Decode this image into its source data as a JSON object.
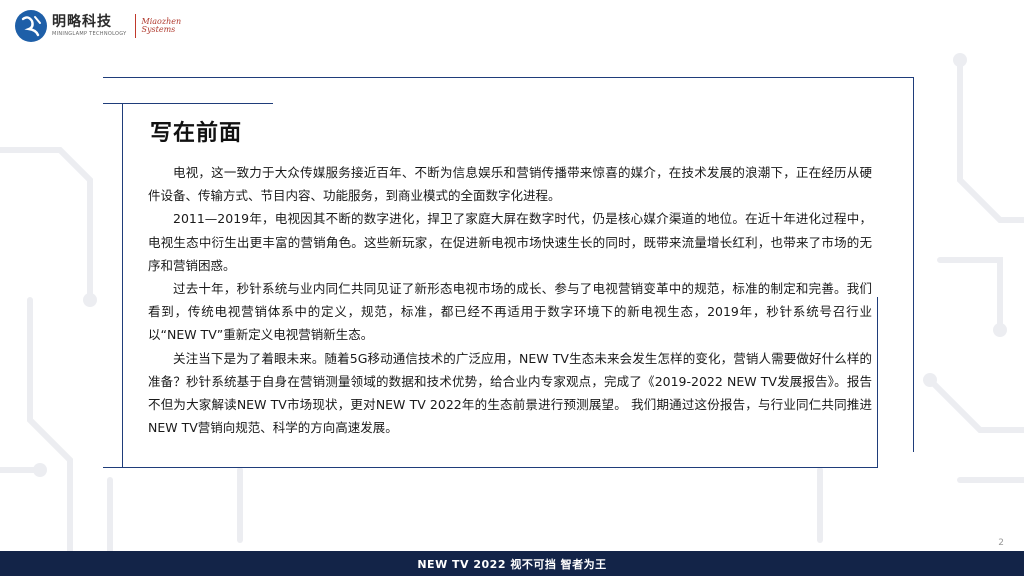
{
  "header": {
    "logo_cn": "明略科技",
    "logo_en": "MININGLAMP TECHNOLOGY",
    "sub_line1": "Miaozhen",
    "sub_line2": "Systems"
  },
  "slide": {
    "title": "写在前面",
    "paragraphs": [
      "电视，这一致力于大众传媒服务接近百年、不断为信息娱乐和营销传播带来惊喜的媒介，在技术发展的浪潮下，正在经历从硬件设备、传输方式、节目内容、功能服务，到商业模式的全面数字化进程。",
      "2011—2019年，电视因其不断的数字进化，捍卫了家庭大屏在数字时代，仍是核心媒介渠道的地位。在近十年进化过程中，电视生态中衍生出更丰富的营销角色。这些新玩家，在促进新电视市场快速生长的同时，既带来流量增长红利，也带来了市场的无序和营销困惑。",
      "过去十年，秒针系统与业内同仁共同见证了新形态电视市场的成长、参与了电视营销变革中的规范，标准的制定和完善。我们看到，传统电视营销体系中的定义，规范，标准，都已经不再适用于数字环境下的新电视生态，2019年，秒针系统号召行业以“NEW TV”重新定义电视营销新生态。",
      "关注当下是为了着眼未来。随着5G移动通信技术的广泛应用，NEW TV生态未来会发生怎样的变化，营销人需要做好什么样的准备？秒针系统基于自身在营销测量领域的数据和技术优势，给合业内专家观点，完成了《2019-2022 NEW TV发展报告》。报告不但为大家解读NEW TV市场现状，更对NEW TV 2022年的生态前景进行预测展望。 我们期通过这份报告，与行业同仁共同推进NEW TV营销向规范、科学的方向高速发展。"
    ],
    "page_number": "2"
  },
  "footer": {
    "text": "NEW TV 2022  视不可挡 智者为王"
  },
  "colors": {
    "accent_line": "#1f3d7a",
    "footer_bg": "#132448",
    "logo_blue": "#1e5fa8",
    "logo_red": "#b03a2e"
  }
}
